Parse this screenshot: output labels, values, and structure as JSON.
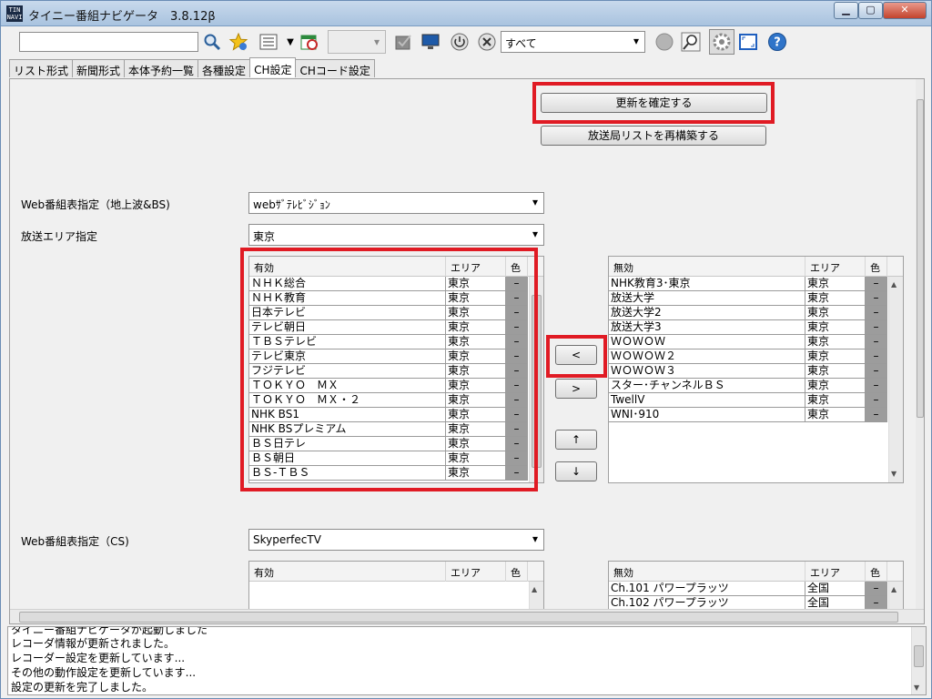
{
  "window": {
    "title": "タイニー番組ナビゲータ　3.8.12β",
    "icon_text": "TIN NAVI",
    "controls": [
      "minimize-icon",
      "maximize-icon",
      "close-icon"
    ]
  },
  "toolbar": {
    "search_value": "",
    "filter_selected": "すべて"
  },
  "tabs": [
    {
      "label": "リスト形式",
      "active": false
    },
    {
      "label": "新聞形式",
      "active": false
    },
    {
      "label": "本体予約一覧",
      "active": false
    },
    {
      "label": "各種設定",
      "active": false
    },
    {
      "label": "CH設定",
      "active": true
    },
    {
      "label": "CHコード設定",
      "active": false
    }
  ],
  "buttons": {
    "apply": "更新を確定する",
    "rebuild": "放送局リストを再構築する",
    "move_left": "<",
    "move_right": ">",
    "move_up": "↑",
    "move_down": "↓"
  },
  "settings": {
    "web_epg_label": "Web番組表指定（地上波&BS)",
    "web_epg_value": "webｻﾞﾃﾚﾋﾞｼﾞｮﾝ",
    "area_label": "放送エリア指定",
    "area_value": "東京",
    "web_epg_cs_label": "Web番組表指定（CS)",
    "web_epg_cs_value": "SkyperfecTV"
  },
  "grid_headers": {
    "enabled": "有効",
    "disabled": "無効",
    "area": "エリア",
    "color": "色"
  },
  "enabled_channels": [
    {
      "name": "ＮＨＫ総合",
      "area": "東京",
      "color": "–"
    },
    {
      "name": "ＮＨＫ教育",
      "area": "東京",
      "color": "–"
    },
    {
      "name": "日本テレビ",
      "area": "東京",
      "color": "–"
    },
    {
      "name": "テレビ朝日",
      "area": "東京",
      "color": "–"
    },
    {
      "name": "ＴＢＳテレビ",
      "area": "東京",
      "color": "–"
    },
    {
      "name": "テレビ東京",
      "area": "東京",
      "color": "–"
    },
    {
      "name": "フジテレビ",
      "area": "東京",
      "color": "–"
    },
    {
      "name": "ＴＯＫＹＯ　ＭＸ",
      "area": "東京",
      "color": "–"
    },
    {
      "name": "ＴＯＫＹＯ　ＭＸ・２",
      "area": "東京",
      "color": "–"
    },
    {
      "name": "NHK BS1",
      "area": "東京",
      "color": "–"
    },
    {
      "name": "NHK BSプレミアム",
      "area": "東京",
      "color": "–"
    },
    {
      "name": "ＢＳ日テレ",
      "area": "東京",
      "color": "–"
    },
    {
      "name": "ＢＳ朝日",
      "area": "東京",
      "color": "–"
    },
    {
      "name": "ＢＳ-ＴＢＳ",
      "area": "東京",
      "color": "–"
    }
  ],
  "disabled_channels": [
    {
      "name": "NHK教育3･東京",
      "area": "東京",
      "color": "–"
    },
    {
      "name": "放送大学",
      "area": "東京",
      "color": "–"
    },
    {
      "name": "放送大学2",
      "area": "東京",
      "color": "–"
    },
    {
      "name": "放送大学3",
      "area": "東京",
      "color": "–"
    },
    {
      "name": "ＷＯＷＯＷ",
      "area": "東京",
      "color": "–"
    },
    {
      "name": "ＷＯＷＯＷ２",
      "area": "東京",
      "color": "–"
    },
    {
      "name": "ＷＯＷＯＷ３",
      "area": "東京",
      "color": "–"
    },
    {
      "name": "スター･チャンネルＢＳ",
      "area": "東京",
      "color": "–"
    },
    {
      "name": "TwellV",
      "area": "東京",
      "color": "–"
    },
    {
      "name": "WNI･910",
      "area": "東京",
      "color": "–"
    }
  ],
  "cs_disabled_channels": [
    {
      "name": "Ch.101 パワープラッツ",
      "area": "全国",
      "color": "–"
    },
    {
      "name": "Ch.102 パワープラッツ",
      "area": "全国",
      "color": "–"
    }
  ],
  "log": [
    "タイニー番組ナビゲータが起動しました",
    "レコーダ情報が更新されました。",
    "レコーダー設定を更新しています...",
    "その他の動作設定を更新しています...",
    "設定の更新を完了しました。"
  ],
  "colors": {
    "highlight": "#e01b24",
    "color_cell": "#9c9c9c"
  }
}
